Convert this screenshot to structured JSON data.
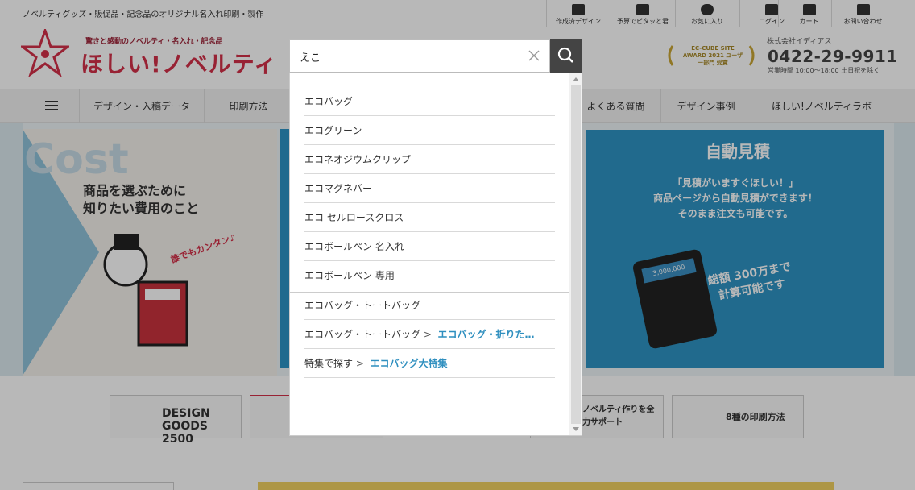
{
  "header": {
    "tagline": "ノベルティグッズ・販促品・記念品のオリジナル名入れ印刷・製作",
    "logo_sub": "驚きと感動のノベルティ・名入れ・記念品",
    "logo_main": "ほしい!ノベルティ",
    "award": "EC-CUBE SITE AWARD 2021 ユーザー部門 受賞",
    "company": "株式会社イディアス",
    "phone": "0422-29-9911",
    "hours": "営業時間 10:00〜18:00 土日祝を除く",
    "util_links": [
      "作成済デザイン",
      "予算でピタッと君",
      "お気に入り",
      "ログイン",
      "カート",
      "お問い合わせ"
    ]
  },
  "nav": {
    "items": [
      "デザイン・入稿データ",
      "印刷方法",
      "よくある質問",
      "デザイン事例",
      "ほしい!ノベルティラボ"
    ]
  },
  "hero": {
    "left_heading": "Cost",
    "left_text": "商品を選ぶために\n知りたい費用のこと",
    "left_note": "誰でもカンタン♪",
    "right_title": "自動見積",
    "right_text": "「見積がいますぐほしい！」\n商品ページから自動見積ができます！\nそのまま注文も可能です。",
    "right_big": "総額 300万まで\n計算可能です",
    "calc_screen": "3,000,000"
  },
  "banners": {
    "design_goods": "DESIGN GOODS 2500",
    "support": "ノベルティ作りを全力サポート",
    "print": "8種の印刷方法"
  },
  "search": {
    "value": "えこ",
    "placeholder": "",
    "suggestions": [
      "エコバッグ",
      "エコグリーン",
      "エコネオジウムクリップ",
      "エコマグネバー",
      "エコ セルロースクロス",
      "エコボールペン 名入れ",
      "エコボールペン 専用"
    ],
    "categories": [
      {
        "path": "エコバッグ・トートバッグ",
        "arrow": "",
        "sub": ""
      },
      {
        "path": "エコバッグ・トートバッグ",
        "arrow": ">",
        "sub": "エコバッグ・折りた…"
      },
      {
        "path": "特集で探す",
        "arrow": ">",
        "sub": "エコバッグ大特集"
      }
    ]
  }
}
